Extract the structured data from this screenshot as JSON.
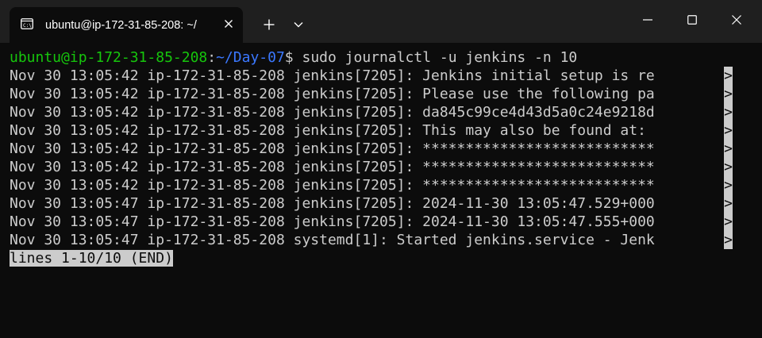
{
  "tab": {
    "icon": "terminal-icon",
    "title": "ubuntu@ip-172-31-85-208: ~/",
    "close_icon": "close-icon"
  },
  "toolbar": {
    "new_tab_icon": "plus-icon",
    "dropdown_icon": "chevron-down-icon"
  },
  "window_controls": {
    "minimize_icon": "minimize-icon",
    "maximize_icon": "maximize-icon",
    "close_icon": "close-icon"
  },
  "colors": {
    "background": "#0c0c0c",
    "titlebar": "#1f1f1f",
    "text": "#cccccc",
    "prompt_user": "#16c60c",
    "prompt_path": "#3b78ff"
  },
  "prompt": {
    "user_host": "ubuntu@ip-172-31-85-208",
    "separator": ":",
    "path": "~/Day-07",
    "symbol": "$",
    "command": " sudo journalctl -u jenkins -n 10"
  },
  "log_lines": [
    "Nov 30 13:05:42 ip-172-31-85-208 jenkins[7205]: Jenkins initial setup is re",
    "Nov 30 13:05:42 ip-172-31-85-208 jenkins[7205]: Please use the following pa",
    "Nov 30 13:05:42 ip-172-31-85-208 jenkins[7205]: da845c99ce4d43d5a0c24e9218d",
    "Nov 30 13:05:42 ip-172-31-85-208 jenkins[7205]: This may also be found at: ",
    "Nov 30 13:05:42 ip-172-31-85-208 jenkins[7205]: ***************************",
    "Nov 30 13:05:42 ip-172-31-85-208 jenkins[7205]: ***************************",
    "Nov 30 13:05:42 ip-172-31-85-208 jenkins[7205]: ***************************",
    "Nov 30 13:05:47 ip-172-31-85-208 jenkins[7205]: 2024-11-30 13:05:47.529+000",
    "Nov 30 13:05:47 ip-172-31-85-208 jenkins[7205]: 2024-11-30 13:05:47.555+000",
    "Nov 30 13:05:47 ip-172-31-85-208 systemd[1]: Started jenkins.service - Jenk"
  ],
  "truncation_marker": ">",
  "pager_status": "lines 1-10/10 (END)"
}
